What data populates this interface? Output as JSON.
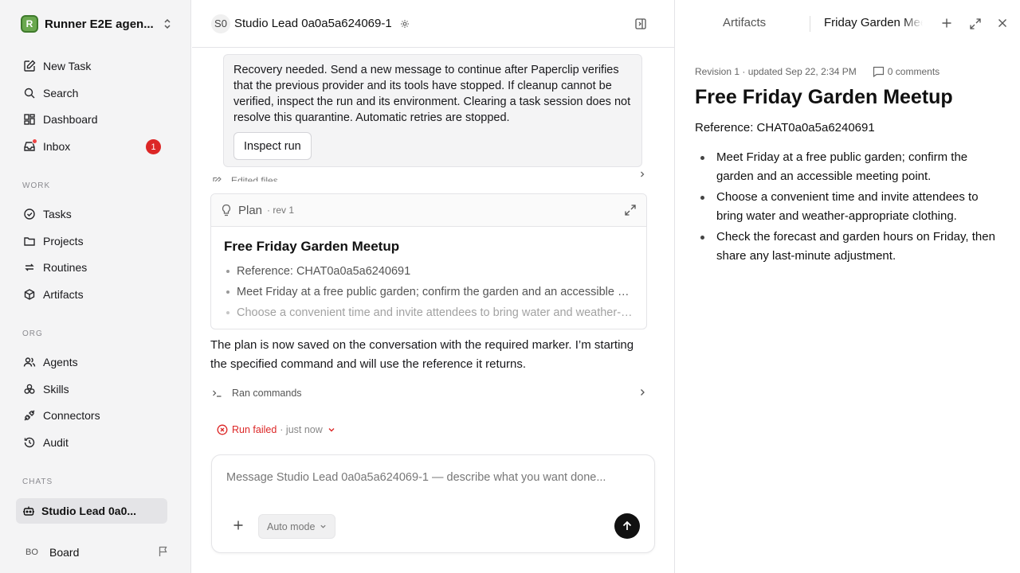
{
  "sidebar": {
    "workspace_name": "Runner E2E agen...",
    "workspace_initial": "R",
    "nav": [
      {
        "label": "New Task",
        "icon": "new-task-icon"
      },
      {
        "label": "Search",
        "icon": "search-icon"
      },
      {
        "label": "Dashboard",
        "icon": "dashboard-icon"
      },
      {
        "label": "Inbox",
        "icon": "inbox-icon",
        "badge": "1"
      }
    ],
    "work_label": "WORK",
    "work": [
      {
        "label": "Tasks",
        "icon": "tasks-icon"
      },
      {
        "label": "Projects",
        "icon": "folder-icon"
      },
      {
        "label": "Routines",
        "icon": "routines-icon"
      },
      {
        "label": "Artifacts",
        "icon": "box-icon"
      }
    ],
    "org_label": "ORG",
    "org": [
      {
        "label": "Agents",
        "icon": "users-icon"
      },
      {
        "label": "Skills",
        "icon": "skills-icon"
      },
      {
        "label": "Connectors",
        "icon": "plug-icon"
      },
      {
        "label": "Audit",
        "icon": "history-icon"
      }
    ],
    "chats_label": "CHATS",
    "chat_item": "Studio Lead 0a0...",
    "board": {
      "initials": "BO",
      "label": "Board"
    }
  },
  "chat": {
    "avatar": "S0",
    "title": "Studio Lead 0a0a5a624069-1",
    "notice_text": "Recovery needed. Send a new message to continue after Paperclip verifies that the previous provider and its tools have stopped. If cleanup cannot be verified, inspect the run and its environment. Clearing a task session does not resolve this quarantine. Automatic retries are stopped.",
    "inspect_button": "Inspect run",
    "edited_files": "Edited files",
    "plan": {
      "label": "Plan",
      "rev": "· rev 1",
      "title": "Free Friday Garden Meetup",
      "items": [
        "Reference: CHAT0a0a5a6240691",
        "Meet Friday at a free public garden; confirm the garden and an accessible meeting point.",
        "Choose a convenient time and invite attendees to bring water and weather-appropriate clothing."
      ]
    },
    "message": "The plan is now saved on the conversation with the required marker. I’m starting the specified command and will use the reference it returns.",
    "ran_commands": "Ran commands",
    "run_status": "Run failed",
    "run_time": "· just now",
    "composer_placeholder": "Message Studio Lead 0a0a5a624069-1 — describe what you want done...",
    "mode": "Auto mode"
  },
  "panel": {
    "tab_artifacts": "Artifacts",
    "tab_doc": "Friday Garden Meetup",
    "meta": "Revision 1 · updated Sep 22, 2:34 PM",
    "comments": "0 comments",
    "title": "Free Friday Garden Meetup",
    "reference": "Reference: CHAT0a0a5a6240691",
    "items": [
      "Meet Friday at a free public garden; confirm the garden and an accessible meeting point.",
      "Choose a convenient time and invite attendees to bring water and weather-appropriate clothing.",
      "Check the forecast and garden hours on Friday, then share any last-minute adjustment."
    ]
  },
  "colors": {
    "accent_red": "#dc2626",
    "send_button": "#111111",
    "sidebar_bg": "#f4f4f5"
  }
}
